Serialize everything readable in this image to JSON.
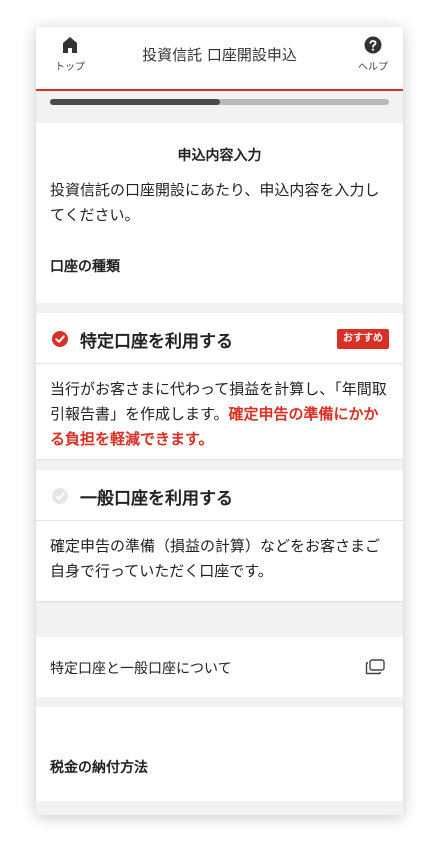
{
  "header": {
    "home_label": "トップ",
    "title": "投資信託 口座開設申込",
    "help_label": "ヘルプ",
    "accent_color": "#d93025"
  },
  "progress": {
    "fraction": 0.5
  },
  "intro": {
    "title": "申込内容入力",
    "description": "投資信託の口座開設にあたり、申込内容を入力してください。",
    "account_type_heading": "口座の種類"
  },
  "options": [
    {
      "title": "特定口座を利用する",
      "selected": true,
      "badge": "おすすめ",
      "description_plain": "当行がお客さまに代わって損益を計算し、「年間取引報告書」を作成します。",
      "description_highlight": "確定申告の準備にかかる負担を軽減できます。"
    },
    {
      "title": "一般口座を利用する",
      "selected": false,
      "description_plain": "確定申告の準備（損益の計算）などをお客さまご自身で行っていただく口座です。"
    }
  ],
  "link": {
    "label": "特定口座と一般口座について",
    "icon": "new-window-icon"
  },
  "tax": {
    "heading": "税金の納付方法"
  }
}
